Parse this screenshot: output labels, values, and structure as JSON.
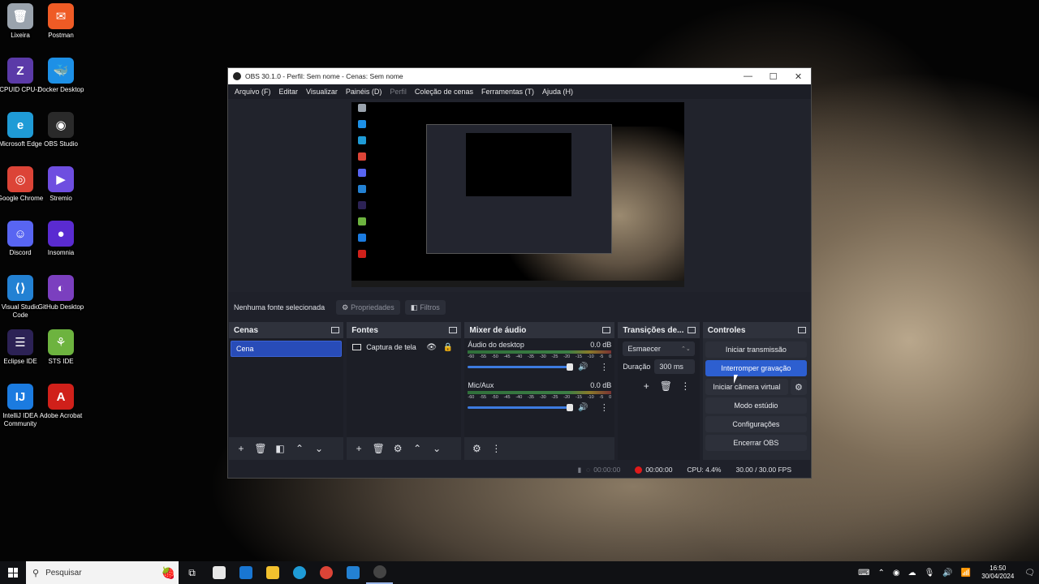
{
  "desktop": {
    "icons": [
      {
        "label": "Lixeira",
        "glyph": "🗑",
        "color": "#9aa3ad"
      },
      {
        "label": "Postman",
        "glyph": "✉",
        "color": "#ef5b25"
      },
      {
        "label": "CPUID CPU-Z",
        "glyph": "Z",
        "color": "#5b3aa8"
      },
      {
        "label": "Docker Desktop",
        "glyph": "🐳",
        "color": "#1d90e6"
      },
      {
        "label": "Microsoft Edge",
        "glyph": "e",
        "color": "#1f9bd6"
      },
      {
        "label": "OBS Studio",
        "glyph": "◉",
        "color": "#2a2a2a"
      },
      {
        "label": "Google Chrome",
        "glyph": "◎",
        "color": "#dc4437"
      },
      {
        "label": "Stremio",
        "glyph": "▶",
        "color": "#6e4ee0"
      },
      {
        "label": "Discord",
        "glyph": "☺",
        "color": "#5865f2"
      },
      {
        "label": "Insomnia",
        "glyph": "●",
        "color": "#5a2bd1"
      },
      {
        "label": "Visual Studio Code",
        "glyph": "⟨⟩",
        "color": "#2381d3"
      },
      {
        "label": "GitHub Desktop",
        "glyph": "◐",
        "color": "#7b3fbf"
      },
      {
        "label": "Eclipse IDE",
        "glyph": "☰",
        "color": "#2c2255"
      },
      {
        "label": "STS IDE",
        "glyph": "⚘",
        "color": "#6db33f"
      },
      {
        "label": "IntelliJ IDEA Community",
        "glyph": "IJ",
        "color": "#1b7be0"
      },
      {
        "label": "Adobe Acrobat",
        "glyph": "A",
        "color": "#d0201a"
      }
    ]
  },
  "obs": {
    "title": "OBS 30.1.0 - Perfil: Sem nome - Cenas: Sem nome",
    "menu": [
      "Arquivo (F)",
      "Editar",
      "Visualizar",
      "Painéis (D)",
      "Perfil",
      "Coleção de cenas",
      "Ferramentas (T)",
      "Ajuda (H)"
    ],
    "menu_disabled": "Perfil",
    "source_toolbar": {
      "no_selection": "Nenhuma fonte selecionada",
      "properties": "Propriedades",
      "filters": "Filtros"
    },
    "scenes": {
      "title": "Cenas",
      "items": [
        "Cena"
      ]
    },
    "sources": {
      "title": "Fontes",
      "items": [
        "Captura de tela"
      ]
    },
    "mixer": {
      "title": "Mixer de áudio",
      "channels": [
        {
          "name": "Áudio do desktop",
          "db": "0.0 dB"
        },
        {
          "name": "Mic/Aux",
          "db": "0.0 dB"
        }
      ],
      "ticks": [
        "-60",
        "-55",
        "-50",
        "-45",
        "-40",
        "-35",
        "-30",
        "-25",
        "-20",
        "-15",
        "-10",
        "-5",
        "0"
      ]
    },
    "transitions": {
      "title": "Transições de...",
      "selected": "Esmaecer",
      "duration_label": "Duração",
      "duration_value": "300 ms"
    },
    "controls": {
      "title": "Controles",
      "start_stream": "Iniciar transmissão",
      "stop_recording": "Interromper gravação",
      "virtual_camera": "Iniciar câmera virtual",
      "studio_mode": "Modo estúdio",
      "settings": "Configurações",
      "exit": "Encerrar OBS"
    },
    "status": {
      "stream_time": "00:00:00",
      "rec_time": "00:00:00",
      "cpu": "CPU: 4.4%",
      "fps": "30.00 / 30.00 FPS"
    }
  },
  "taskbar": {
    "search_placeholder": "Pesquisar",
    "time": "16:50",
    "date": "30/04/2024"
  },
  "colors": {
    "accent": "#2d5fd0",
    "scene_selected": "#284cb8",
    "record_dot": "#e01a1a"
  }
}
